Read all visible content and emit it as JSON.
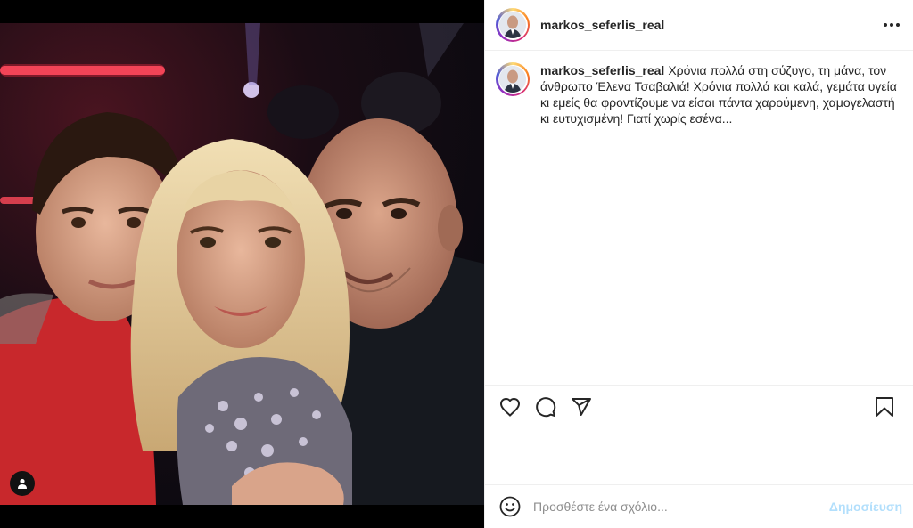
{
  "post": {
    "username": "markos_seferlis_real",
    "caption_username": "markos_seferlis_real",
    "caption_text": "Χρόνια πολλά στη σύζυγο, τη μάνα, τον άνθρωπο Έλενα Τσαβαλιά! Χρόνια πολλά και καλά, γεμάτα υγεία κι εμείς θα φροντίζουμε να είσαι πάντα χαρούμενη, χαμογελαστή κι ευτυχισμένη! Γιατί χωρίς εσένα..."
  },
  "comment": {
    "placeholder": "Προσθέστε ένα σχόλιο...",
    "post_label": "Δημοσίευση"
  },
  "icons": {
    "more": "more-horizontal-icon",
    "like": "heart-icon",
    "comment": "comment-icon",
    "share": "share-icon",
    "save": "bookmark-icon",
    "emoji": "emoji-icon",
    "tag": "user-tag-icon"
  },
  "colors": {
    "post_button": "#b2dffc",
    "border": "#efefef",
    "text": "#262626",
    "placeholder": "#8e8e8e"
  }
}
